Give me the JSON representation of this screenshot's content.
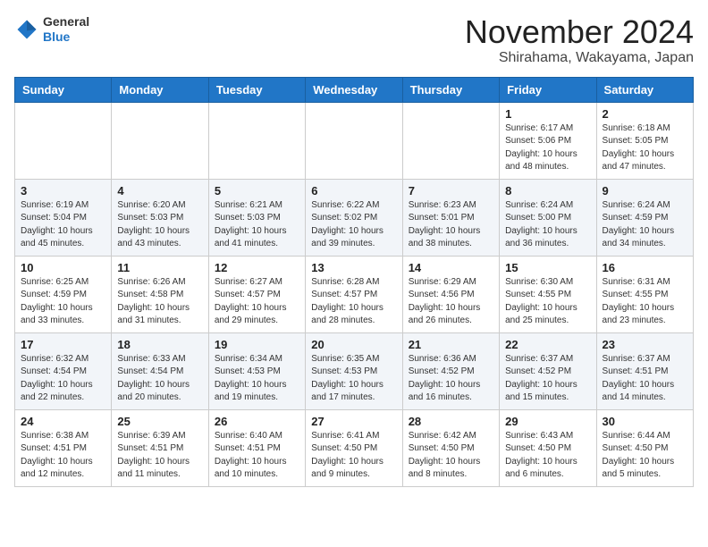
{
  "header": {
    "logo_line1": "General",
    "logo_line2": "Blue",
    "month": "November 2024",
    "location": "Shirahama, Wakayama, Japan"
  },
  "weekdays": [
    "Sunday",
    "Monday",
    "Tuesday",
    "Wednesday",
    "Thursday",
    "Friday",
    "Saturday"
  ],
  "weeks": [
    [
      {
        "day": "",
        "info": ""
      },
      {
        "day": "",
        "info": ""
      },
      {
        "day": "",
        "info": ""
      },
      {
        "day": "",
        "info": ""
      },
      {
        "day": "",
        "info": ""
      },
      {
        "day": "1",
        "info": "Sunrise: 6:17 AM\nSunset: 5:06 PM\nDaylight: 10 hours\nand 48 minutes."
      },
      {
        "day": "2",
        "info": "Sunrise: 6:18 AM\nSunset: 5:05 PM\nDaylight: 10 hours\nand 47 minutes."
      }
    ],
    [
      {
        "day": "3",
        "info": "Sunrise: 6:19 AM\nSunset: 5:04 PM\nDaylight: 10 hours\nand 45 minutes."
      },
      {
        "day": "4",
        "info": "Sunrise: 6:20 AM\nSunset: 5:03 PM\nDaylight: 10 hours\nand 43 minutes."
      },
      {
        "day": "5",
        "info": "Sunrise: 6:21 AM\nSunset: 5:03 PM\nDaylight: 10 hours\nand 41 minutes."
      },
      {
        "day": "6",
        "info": "Sunrise: 6:22 AM\nSunset: 5:02 PM\nDaylight: 10 hours\nand 39 minutes."
      },
      {
        "day": "7",
        "info": "Sunrise: 6:23 AM\nSunset: 5:01 PM\nDaylight: 10 hours\nand 38 minutes."
      },
      {
        "day": "8",
        "info": "Sunrise: 6:24 AM\nSunset: 5:00 PM\nDaylight: 10 hours\nand 36 minutes."
      },
      {
        "day": "9",
        "info": "Sunrise: 6:24 AM\nSunset: 4:59 PM\nDaylight: 10 hours\nand 34 minutes."
      }
    ],
    [
      {
        "day": "10",
        "info": "Sunrise: 6:25 AM\nSunset: 4:59 PM\nDaylight: 10 hours\nand 33 minutes."
      },
      {
        "day": "11",
        "info": "Sunrise: 6:26 AM\nSunset: 4:58 PM\nDaylight: 10 hours\nand 31 minutes."
      },
      {
        "day": "12",
        "info": "Sunrise: 6:27 AM\nSunset: 4:57 PM\nDaylight: 10 hours\nand 29 minutes."
      },
      {
        "day": "13",
        "info": "Sunrise: 6:28 AM\nSunset: 4:57 PM\nDaylight: 10 hours\nand 28 minutes."
      },
      {
        "day": "14",
        "info": "Sunrise: 6:29 AM\nSunset: 4:56 PM\nDaylight: 10 hours\nand 26 minutes."
      },
      {
        "day": "15",
        "info": "Sunrise: 6:30 AM\nSunset: 4:55 PM\nDaylight: 10 hours\nand 25 minutes."
      },
      {
        "day": "16",
        "info": "Sunrise: 6:31 AM\nSunset: 4:55 PM\nDaylight: 10 hours\nand 23 minutes."
      }
    ],
    [
      {
        "day": "17",
        "info": "Sunrise: 6:32 AM\nSunset: 4:54 PM\nDaylight: 10 hours\nand 22 minutes."
      },
      {
        "day": "18",
        "info": "Sunrise: 6:33 AM\nSunset: 4:54 PM\nDaylight: 10 hours\nand 20 minutes."
      },
      {
        "day": "19",
        "info": "Sunrise: 6:34 AM\nSunset: 4:53 PM\nDaylight: 10 hours\nand 19 minutes."
      },
      {
        "day": "20",
        "info": "Sunrise: 6:35 AM\nSunset: 4:53 PM\nDaylight: 10 hours\nand 17 minutes."
      },
      {
        "day": "21",
        "info": "Sunrise: 6:36 AM\nSunset: 4:52 PM\nDaylight: 10 hours\nand 16 minutes."
      },
      {
        "day": "22",
        "info": "Sunrise: 6:37 AM\nSunset: 4:52 PM\nDaylight: 10 hours\nand 15 minutes."
      },
      {
        "day": "23",
        "info": "Sunrise: 6:37 AM\nSunset: 4:51 PM\nDaylight: 10 hours\nand 14 minutes."
      }
    ],
    [
      {
        "day": "24",
        "info": "Sunrise: 6:38 AM\nSunset: 4:51 PM\nDaylight: 10 hours\nand 12 minutes."
      },
      {
        "day": "25",
        "info": "Sunrise: 6:39 AM\nSunset: 4:51 PM\nDaylight: 10 hours\nand 11 minutes."
      },
      {
        "day": "26",
        "info": "Sunrise: 6:40 AM\nSunset: 4:51 PM\nDaylight: 10 hours\nand 10 minutes."
      },
      {
        "day": "27",
        "info": "Sunrise: 6:41 AM\nSunset: 4:50 PM\nDaylight: 10 hours\nand 9 minutes."
      },
      {
        "day": "28",
        "info": "Sunrise: 6:42 AM\nSunset: 4:50 PM\nDaylight: 10 hours\nand 8 minutes."
      },
      {
        "day": "29",
        "info": "Sunrise: 6:43 AM\nSunset: 4:50 PM\nDaylight: 10 hours\nand 6 minutes."
      },
      {
        "day": "30",
        "info": "Sunrise: 6:44 AM\nSunset: 4:50 PM\nDaylight: 10 hours\nand 5 minutes."
      }
    ]
  ]
}
